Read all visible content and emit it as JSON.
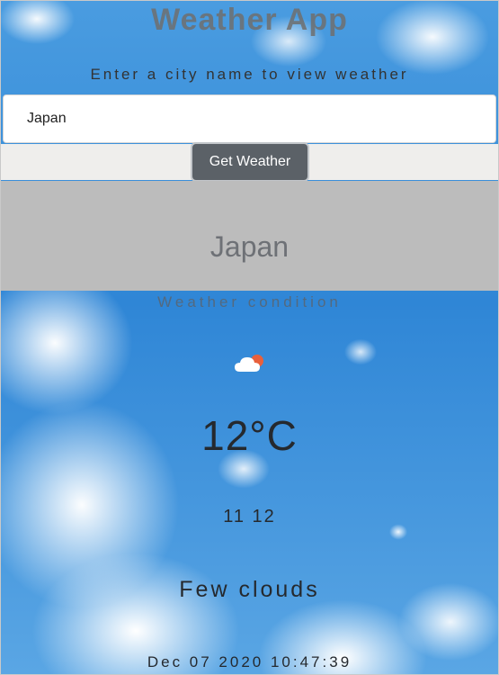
{
  "app": {
    "title": "Weather App",
    "subtitle": "Enter a city name to view weather"
  },
  "search": {
    "value": "Japan",
    "button_label": "Get Weather"
  },
  "result": {
    "city": "Japan",
    "condition_label": "Weather condition",
    "icon": "few-clouds-icon",
    "temperature": "12°C",
    "minmax": "11 12",
    "description": "Few clouds",
    "datetime": "Dec 07 2020 10:47:39"
  },
  "colors": {
    "button": "#5b6167",
    "city_band": "#bcbcbc",
    "sky": "#3f93dc",
    "sun": "#e8603c"
  }
}
